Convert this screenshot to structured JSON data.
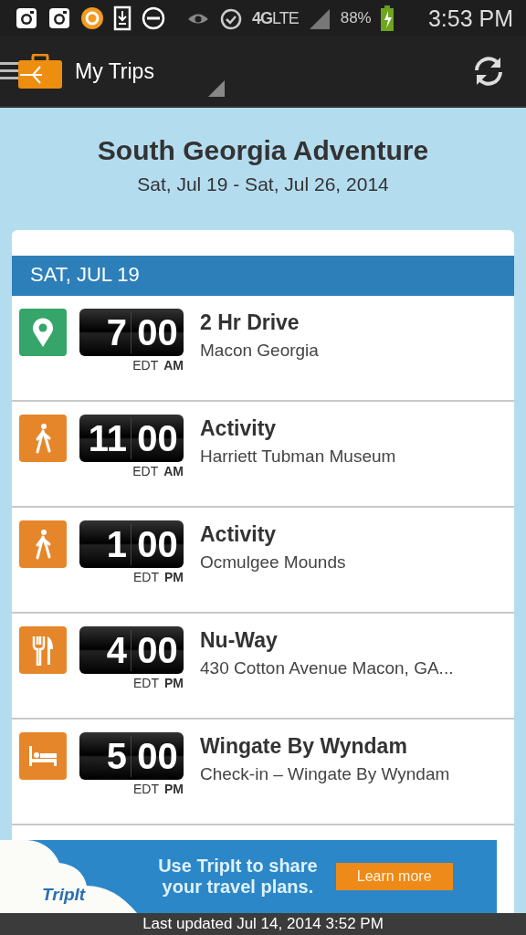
{
  "status_bar": {
    "network": "4G",
    "network_sub": "LTE",
    "battery": "88%",
    "time": "3:53 PM"
  },
  "app_bar": {
    "title": "My Trips"
  },
  "trip": {
    "title": "South Georgia Adventure",
    "dates": "Sat, Jul 19 - Sat, Jul 26, 2014"
  },
  "day": {
    "label": "SAT, JUL 19"
  },
  "items": [
    {
      "kind": "pin",
      "hour": "7",
      "minute": "00",
      "zone": "EDT",
      "ampm": "AM",
      "title": "2 Hr Drive",
      "subtitle": "Macon Georgia"
    },
    {
      "kind": "walk",
      "hour": "11",
      "minute": "00",
      "zone": "EDT",
      "ampm": "AM",
      "title": "Activity",
      "subtitle": "Harriett Tubman Museum"
    },
    {
      "kind": "walk",
      "hour": "1",
      "minute": "00",
      "zone": "EDT",
      "ampm": "PM",
      "title": "Activity",
      "subtitle": "Ocmulgee Mounds"
    },
    {
      "kind": "food",
      "hour": "4",
      "minute": "00",
      "zone": "EDT",
      "ampm": "PM",
      "title": "Nu-Way",
      "subtitle": "430 Cotton Avenue Macon, GA..."
    },
    {
      "kind": "bed",
      "hour": "5",
      "minute": "00",
      "zone": "EDT",
      "ampm": "PM",
      "title": "Wingate By Wyndam",
      "subtitle": "Check-in – Wingate By Wyndam"
    }
  ],
  "ad": {
    "logo": "TripIt",
    "message": [
      "Use TripIt to share",
      "your travel plans."
    ],
    "button": "Learn more"
  },
  "footer": {
    "text": "Last updated Jul 14, 2014 3:52 PM"
  }
}
